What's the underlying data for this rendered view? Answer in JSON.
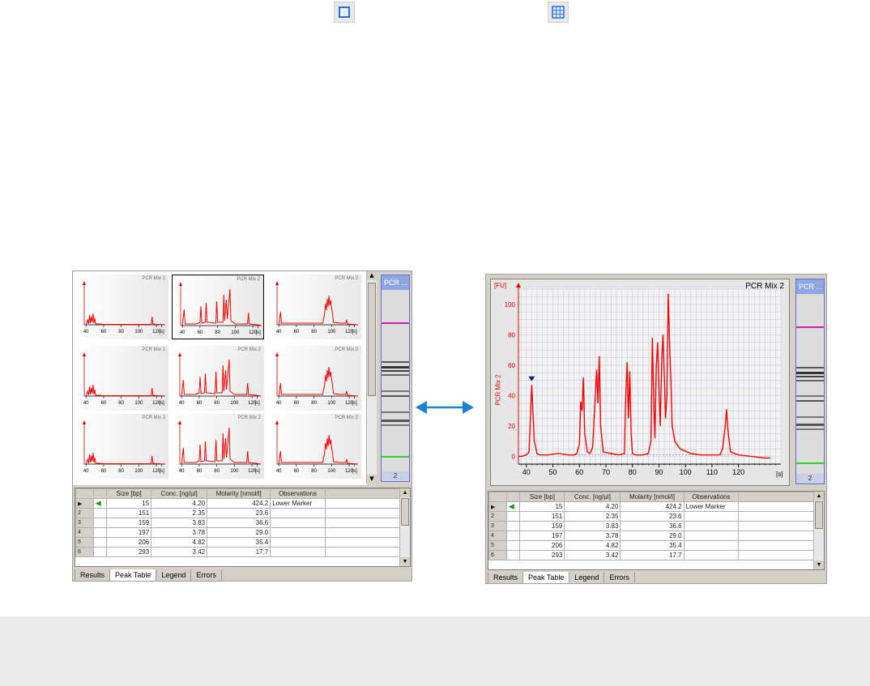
{
  "toolbar": {
    "single_view_icon": "single-view-icon",
    "grid_view_icon": "grid-view-icon"
  },
  "left_window": {
    "thumbnails": [
      {
        "title": "PCR Mix 1",
        "ticks": [
          "40",
          "60",
          "80",
          "100",
          "120",
          "[s]"
        ]
      },
      {
        "title": "PCR Mix 2",
        "ticks": [
          "40",
          "60",
          "80",
          "100",
          "120",
          "[s]"
        ]
      },
      {
        "title": "PCR Mix 3",
        "ticks": [
          "40",
          "60",
          "80",
          "100",
          "120",
          "[s]"
        ]
      },
      {
        "title": "PCR Mix 1",
        "ticks": [
          "40",
          "60",
          "80",
          "100",
          "120",
          "[s]"
        ]
      },
      {
        "title": "PCR Mix 2",
        "ticks": [
          "40",
          "60",
          "80",
          "100",
          "120",
          "[s]"
        ]
      },
      {
        "title": "PCR Mix 3",
        "ticks": [
          "40",
          "60",
          "80",
          "100",
          "120",
          "[s]"
        ]
      },
      {
        "title": "PCR Mix 1",
        "ticks": [
          "40",
          "60",
          "80",
          "100",
          "120",
          "[s]"
        ]
      },
      {
        "title": "PCR Mix 2",
        "ticks": [
          "40",
          "60",
          "80",
          "100",
          "120",
          "[s]"
        ]
      },
      {
        "title": "PCR Mix 3",
        "ticks": [
          "40",
          "60",
          "80",
          "100",
          "120",
          "[s]"
        ]
      }
    ],
    "gel_header": "PCR ...",
    "gel_lane": "2"
  },
  "right_window": {
    "chart_title": "PCR Mix 2",
    "y_unit": "[FU]",
    "y_label": "PCR Mix 2",
    "x_unit": "[s]",
    "gel_header": "PCR ...",
    "gel_lane": "2"
  },
  "table": {
    "columns": [
      "Size [bp]",
      "Conc. [ng/µl]",
      "Molarity [nmol/l]",
      "Observations"
    ],
    "rows": [
      {
        "id": "",
        "size": "15",
        "conc": "4.20",
        "molarity": "424.2",
        "obs": "Lower Marker"
      },
      {
        "id": "2",
        "size": "151",
        "conc": "2.35",
        "molarity": "23.6",
        "obs": ""
      },
      {
        "id": "3",
        "size": "159",
        "conc": "3.83",
        "molarity": "36.6",
        "obs": ""
      },
      {
        "id": "4",
        "size": "197",
        "conc": "3.78",
        "molarity": "29.0",
        "obs": ""
      },
      {
        "id": "5",
        "size": "206",
        "conc": "4.82",
        "molarity": "35.4",
        "obs": ""
      },
      {
        "id": "6",
        "size": "293",
        "conc": "3.42",
        "molarity": "17.7",
        "obs": ""
      }
    ]
  },
  "tabs": [
    "Results",
    "Peak Table",
    "Legend",
    "Errors"
  ],
  "active_tab": "Peak Table",
  "colors": {
    "trace": "#ff0000",
    "arrow": "#1f7fd0",
    "upper_marker": "#e020c0",
    "lower_marker": "#30d030"
  },
  "chart_data": {
    "type": "line",
    "title": "PCR Mix 2",
    "xlabel": "[s]",
    "ylabel": "[FU]",
    "xlim": [
      37,
      136
    ],
    "ylim": [
      -5,
      110
    ],
    "x_ticks": [
      "40",
      "50",
      "60",
      "70",
      "80",
      "90",
      "100",
      "110",
      "120"
    ],
    "y_ticks": [
      "0",
      "20",
      "40",
      "60",
      "80",
      "100"
    ],
    "grid": true,
    "series": [
      {
        "name": "PCR Mix 2",
        "x": [
          37,
          38,
          40,
          41,
          42,
          43,
          44,
          45,
          48,
          52,
          56,
          58,
          59,
          60,
          60.5,
          61,
          61.5,
          62,
          63,
          64,
          65,
          66,
          66.5,
          67,
          67.5,
          68,
          69,
          72,
          75,
          77,
          77.5,
          78,
          78.5,
          79,
          79.5,
          80,
          81,
          84,
          86,
          87,
          87.5,
          88,
          88.5,
          89,
          89.5,
          90,
          90.5,
          91,
          91.5,
          92,
          92.5,
          93,
          93.5,
          94,
          94.5,
          95,
          96,
          98,
          102,
          106,
          110,
          113,
          114,
          115,
          115.5,
          116,
          117,
          120,
          125,
          130,
          132
        ],
        "y": [
          0,
          0,
          1,
          3,
          47,
          10,
          2,
          1,
          1,
          2,
          1,
          1,
          2,
          8,
          36,
          30,
          52,
          15,
          3,
          2,
          6,
          40,
          57,
          35,
          66,
          20,
          3,
          2,
          1,
          2,
          40,
          62,
          25,
          56,
          15,
          2,
          1,
          1,
          2,
          10,
          78,
          40,
          12,
          60,
          75,
          45,
          20,
          60,
          80,
          55,
          25,
          40,
          107,
          75,
          50,
          20,
          10,
          5,
          2,
          1,
          1,
          1,
          5,
          20,
          31,
          18,
          3,
          1,
          0,
          -1,
          -1
        ]
      }
    ]
  }
}
